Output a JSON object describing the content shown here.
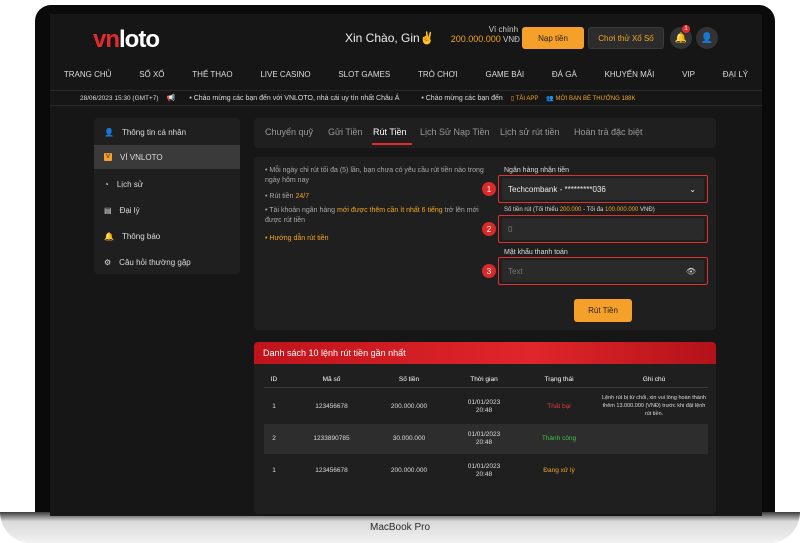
{
  "brand": {
    "logo_vn": "vn",
    "logo_loto": "loto",
    "device": "MacBook Pro"
  },
  "header": {
    "greeting": "Xin Chào, Gin✌",
    "wallet_label": "Ví chính ⌄",
    "wallet_amount": "200.000.000",
    "wallet_unit": "VNĐ ●",
    "deposit_button": "Nạp tiền",
    "play_button": "Chơi thử Xổ Số",
    "notify_count": "1",
    "accent": "#f5a02a",
    "brand_red": "#e32b2b"
  },
  "nav": [
    "TRANG CHỦ",
    "SỐ XỐ",
    "THỂ THAO",
    "LIVE CASINO",
    "SLOT GAMES",
    "TRÒ CHƠI",
    "GAME BÀI",
    "ĐÁ GÀ",
    "KHUYẾN MÃI",
    "VIP",
    "ĐẠI LÝ"
  ],
  "ticker": {
    "datetime": "28/06/2023 15:30 (GMT+7)",
    "message1": "• Chào mừng các bạn đến với VNLOTO, nhà cái uy tín nhất Châu Á",
    "message2": "• Chào mừng các bạn đến",
    "app_link": "TẢI APP",
    "invite_link": "MỜI BẠN BÈ THƯỞNG 188K"
  },
  "sidebar": [
    {
      "label": "Thông tin cá nhân",
      "icon": "user-icon"
    },
    {
      "label": "VÍ VNLOTO",
      "icon": "wallet-icon"
    },
    {
      "label": "Lịch sử",
      "icon": "clock-icon"
    },
    {
      "label": "Đại lý",
      "icon": "agent-icon"
    },
    {
      "label": "Thông báo",
      "icon": "bell-icon"
    },
    {
      "label": "Câu hỏi thường gặp",
      "icon": "gear-icon"
    }
  ],
  "tabs": [
    "Chuyển quỹ",
    "Gửi Tiền",
    "Rút Tiền",
    "Lịch Sử Nạp Tiền",
    "Lịch sử rút tiền",
    "Hoàn trả đặc biệt"
  ],
  "form": {
    "note1": "• Mỗi ngày chỉ rút tối đa (5) lần, bạn chưa có yêu cầu rút tiền nào trong ngày hôm nay",
    "note2_prefix": "• Rút tiền",
    "note2_value": "24/7",
    "note3_prefix": "• Tài khoản ngân hàng",
    "note3_bold": "mới được thêm cần ít nhất 6 tiếng",
    "note3_suffix": "trở lên mới được rút tiền",
    "guide": "• Hướng dẫn rút tiền",
    "bank_label": "Ngân hàng nhận tiền",
    "bank_value": "Techcombank - *********036",
    "amount_label_prefix": "Số tiền rút (Tối thiểu",
    "amount_min": "200.000",
    "amount_mid": "- Tối đa",
    "amount_max": "100.000.000",
    "amount_unit": "VNĐ)",
    "amount_placeholder": "0",
    "password_label": "Mật khẩu thanh toán",
    "password_placeholder": "Text",
    "submit": "Rút Tiền",
    "markers": [
      "1",
      "2",
      "3"
    ]
  },
  "history": {
    "title": "Danh sách 10 lệnh rút tiền gần nhất",
    "headers": [
      "ID",
      "Mã số",
      "Số tiền",
      "Thời gian",
      "Trạng thái",
      "Ghi chú"
    ],
    "rows": [
      {
        "id": "1",
        "code": "123456678",
        "amount": "200.000.000",
        "date": "01/01/2023",
        "time": "20:48",
        "status": "Thất bại",
        "status_color": "#e53935",
        "note": "Lệnh rút bị từ chối, xin vui lòng hoàn thành thêm 13.000.000 (VNĐ) trước khi đặt lệnh rút tiền."
      },
      {
        "id": "2",
        "code": "1233890785",
        "amount": "30.000.000",
        "date": "01/01/2023",
        "time": "20:48",
        "status": "Thành công",
        "status_color": "#3ec34a",
        "note": ""
      },
      {
        "id": "1",
        "code": "123456678",
        "amount": "200.000.000",
        "date": "01/01/2023",
        "time": "20:48",
        "status": "Đang xử lý",
        "status_color": "#f5a623",
        "note": ""
      }
    ]
  }
}
